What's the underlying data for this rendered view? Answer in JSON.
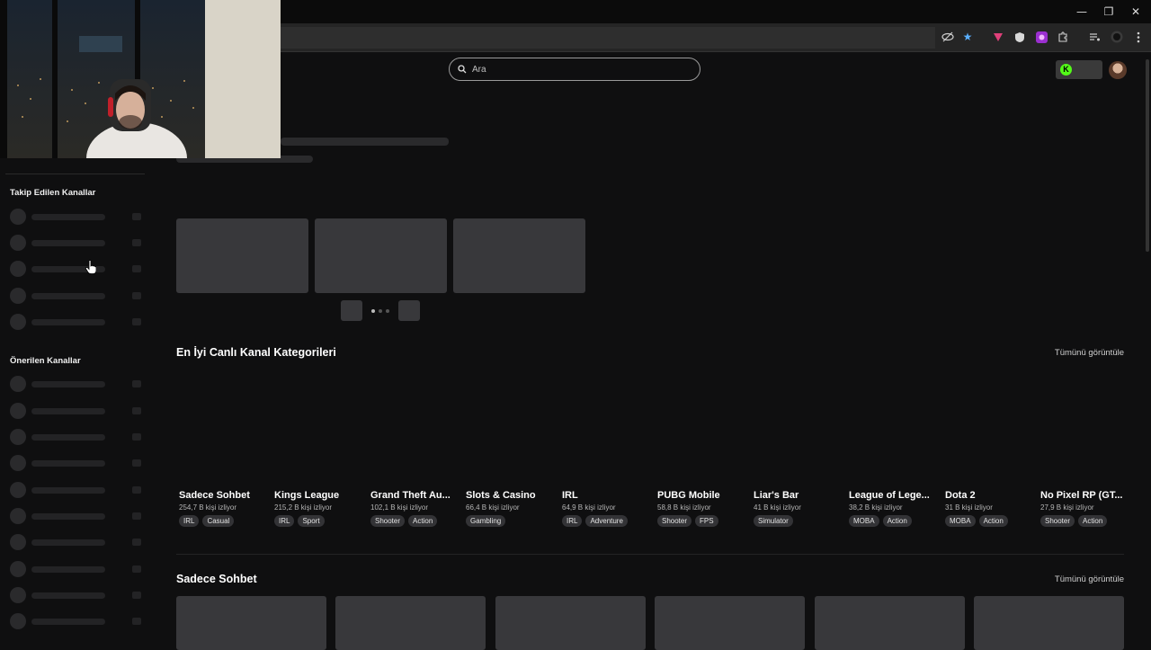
{
  "header": {
    "search_placeholder": "Ara"
  },
  "window_controls": {
    "minimize": "—",
    "restore": "❐",
    "close": "✕"
  },
  "sidebar": {
    "followed_title": "Takip Edilen Kanallar",
    "recommended_title": "Önerilen Kanallar"
  },
  "top_categories": {
    "title": "En İyi Canlı Kanal Kategorileri",
    "view_all": "Tümünü görüntüle",
    "items": [
      {
        "name": "Sadece Sohbet",
        "viewers": "254,7 B kişi izliyor",
        "tags": [
          "IRL",
          "Casual"
        ]
      },
      {
        "name": "Kings League",
        "viewers": "215,2 B kişi izliyor",
        "tags": [
          "IRL",
          "Sport"
        ]
      },
      {
        "name": "Grand Theft Au...",
        "viewers": "102,1 B kişi izliyor",
        "tags": [
          "Shooter",
          "Action"
        ]
      },
      {
        "name": "Slots & Casino",
        "viewers": "66,4 B kişi izliyor",
        "tags": [
          "Gambling"
        ]
      },
      {
        "name": "IRL",
        "viewers": "64,9 B kişi izliyor",
        "tags": [
          "IRL",
          "Adventure"
        ]
      },
      {
        "name": "PUBG Mobile",
        "viewers": "58,8 B kişi izliyor",
        "tags": [
          "Shooter",
          "FPS"
        ]
      },
      {
        "name": "Liar's Bar",
        "viewers": "41 B kişi izliyor",
        "tags": [
          "Simulator"
        ]
      },
      {
        "name": "League of Lege...",
        "viewers": "38,2 B kişi izliyor",
        "tags": [
          "MOBA",
          "Action"
        ]
      },
      {
        "name": "Dota 2",
        "viewers": "31 B kişi izliyor",
        "tags": [
          "MOBA",
          "Action"
        ]
      },
      {
        "name": "No Pixel RP (GT...",
        "viewers": "27,9 B kişi izliyor",
        "tags": [
          "Shooter",
          "Action"
        ]
      }
    ]
  },
  "chat_section": {
    "title": "Sadece Sohbet",
    "view_all": "Tümünü görüntüle"
  },
  "colors": {
    "background": "#0f0f10",
    "skeleton": "#38383b",
    "kick_green": "#53fc18"
  },
  "icons": [
    "eye-off-icon",
    "star-icon",
    "shield-icon",
    "extensions-icon",
    "media-icon",
    "profile-icon",
    "menu-icon",
    "search-icon",
    "kick-logo-icon"
  ]
}
